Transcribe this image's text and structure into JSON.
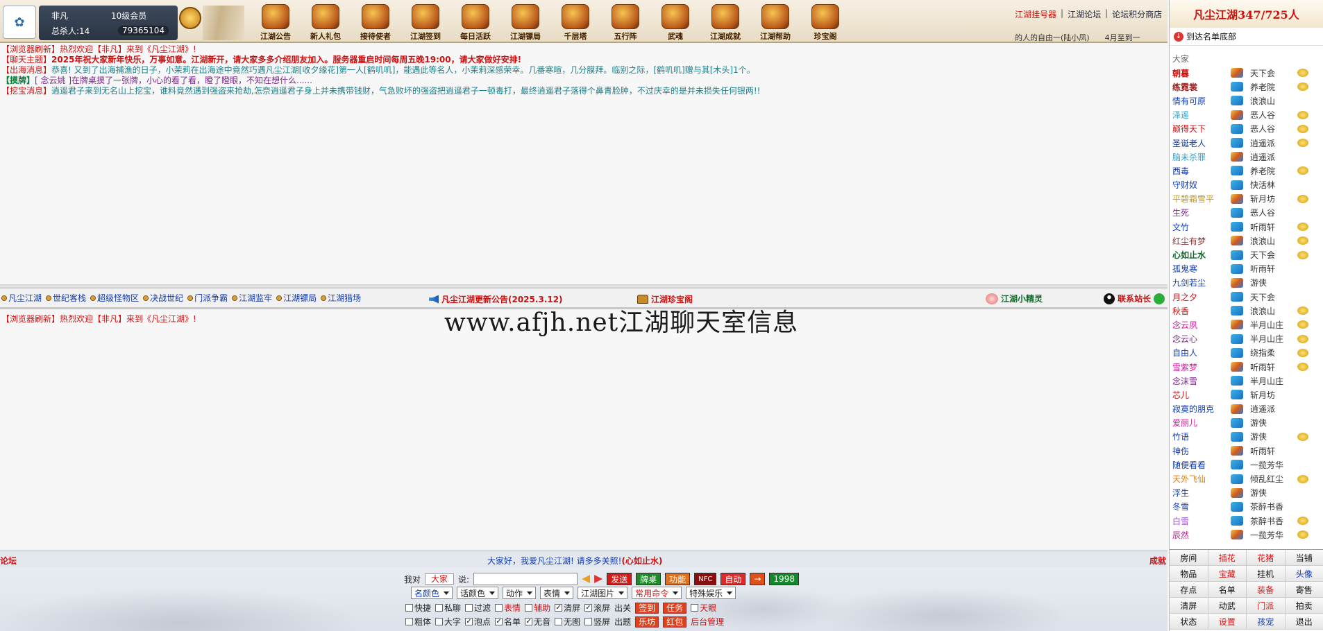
{
  "user": {
    "name": "非凡",
    "level": "10级会员",
    "kills_label": "总杀人:14",
    "gold": "79365104"
  },
  "nav": [
    "江湖公告",
    "新人礼包",
    "接待使者",
    "江湖签到",
    "每日活跃",
    "江湖镖局",
    "千层塔",
    "五行阵",
    "武魂",
    "江湖成就",
    "江湖帮助",
    "珍宝阁"
  ],
  "toplinks": [
    "江湖挂号器",
    "江湖论坛",
    "论坛积分商店"
  ],
  "ticker": [
    "的人的自由一(陆小凤)",
    "4月至到一"
  ],
  "right": {
    "title": "凡尘江湖347/725人",
    "scroll_label": "到达名单底部",
    "room": "大家",
    "users": [
      {
        "name": "朝暮",
        "sect": "天下会",
        "color": "#c11",
        "bold": true,
        "badge": true
      },
      {
        "name": "练霓裳",
        "sect": "养老院",
        "color": "#9a2020",
        "bold": true,
        "badge": true
      },
      {
        "name": "情有可原",
        "sect": "浪浪山",
        "color": "#123bb0",
        "badge": false
      },
      {
        "name": "泽遥",
        "sect": "恶人谷",
        "color": "#3aa0c0",
        "badge": true
      },
      {
        "name": "巅得天下",
        "sect": "恶人谷",
        "color": "#c11",
        "badge": true
      },
      {
        "name": "圣诞老人",
        "sect": "逍遥派",
        "color": "#123bb0",
        "badge": true
      },
      {
        "name": "脑未杀罪",
        "sect": "逍遥派",
        "color": "#3aa0c0",
        "badge": false
      },
      {
        "name": "西毒",
        "sect": "养老院",
        "color": "#123bb0",
        "badge": true
      },
      {
        "name": "守财奴",
        "sect": "快活林",
        "color": "#123bb0",
        "badge": false
      },
      {
        "name": "平碧霜雪平",
        "sect": "斩月坊",
        "color": "#c99a10",
        "badge": true
      },
      {
        "name": "生死",
        "sect": "恶人谷",
        "color": "#7a2a8a",
        "badge": false
      },
      {
        "name": "文竹",
        "sect": "听雨轩",
        "color": "#123bb0",
        "badge": true
      },
      {
        "name": "红尘有梦",
        "sect": "浪浪山",
        "color": "#8a3a3a",
        "badge": true
      },
      {
        "name": "心如止水",
        "sect": "天下会",
        "color": "#0d6a28",
        "bold": true,
        "badge": true
      },
      {
        "name": "孤鬼寒",
        "sect": "听雨轩",
        "color": "#123bb0",
        "badge": false
      },
      {
        "name": "九剑若尘",
        "sect": "游侠",
        "color": "#123bb0",
        "badge": false
      },
      {
        "name": "月之夕",
        "sect": "天下会",
        "color": "#c11",
        "badge": false
      },
      {
        "name": "秋香",
        "sect": "浪浪山",
        "color": "#c11",
        "badge": true
      },
      {
        "name": "念云夙",
        "sect": "半月山庄",
        "color": "#d01a9a",
        "badge": true
      },
      {
        "name": "念云心",
        "sect": "半月山庄",
        "color": "#7a2a8a",
        "badge": true
      },
      {
        "name": "自由人",
        "sect": "绕指柔",
        "color": "#123bb0",
        "badge": true
      },
      {
        "name": "雪紫梦",
        "sect": "听雨轩",
        "color": "#d01a9a",
        "badge": true
      },
      {
        "name": "念沫雪",
        "sect": "半月山庄",
        "color": "#7a2a8a",
        "badge": false
      },
      {
        "name": "芯儿",
        "sect": "斩月坊",
        "color": "#c11",
        "badge": false
      },
      {
        "name": "寂寞的朋克",
        "sect": "逍遥派",
        "color": "#123bb0",
        "badge": false
      },
      {
        "name": "爱丽儿",
        "sect": "游侠",
        "color": "#d01a9a",
        "badge": false
      },
      {
        "name": "竹语",
        "sect": "游侠",
        "color": "#123bb0",
        "badge": true
      },
      {
        "name": "神伤",
        "sect": "听雨轩",
        "color": "#123bb0",
        "badge": false
      },
      {
        "name": "随便看看",
        "sect": "一揽芳华",
        "color": "#123bb0",
        "badge": false
      },
      {
        "name": "天外飞仙",
        "sect": "倾乱红尘",
        "color": "#e0801a",
        "badge": true
      },
      {
        "name": "浮生",
        "sect": "游侠",
        "color": "#123bb0",
        "badge": false
      },
      {
        "name": "冬雪",
        "sect": "茶醉书香",
        "color": "#123bb0",
        "badge": false
      },
      {
        "name": "白雪",
        "sect": "茶醉书香",
        "color": "#9a50d0",
        "badge": true
      },
      {
        "name": "辰然",
        "sect": "一揽芳华",
        "color": "#d01a9a",
        "badge": true
      }
    ],
    "grid": [
      {
        "label": "房间",
        "c": ""
      },
      {
        "label": "插花",
        "c": "red"
      },
      {
        "label": "花猪",
        "c": "red"
      },
      {
        "label": "当铺",
        "c": ""
      },
      {
        "label": "物品",
        "c": ""
      },
      {
        "label": "宝藏",
        "c": "red"
      },
      {
        "label": "挂机",
        "c": ""
      },
      {
        "label": "头像",
        "c": "blue"
      },
      {
        "label": "存点",
        "c": ""
      },
      {
        "label": "名单",
        "c": ""
      },
      {
        "label": "装备",
        "c": "red"
      },
      {
        "label": "寄售",
        "c": ""
      },
      {
        "label": "清屏",
        "c": ""
      },
      {
        "label": "动武",
        "c": ""
      },
      {
        "label": "门派",
        "c": "red"
      },
      {
        "label": "拍卖",
        "c": ""
      },
      {
        "label": "状态",
        "c": ""
      },
      {
        "label": "设置",
        "c": "red"
      },
      {
        "label": "孩宠",
        "c": "blue"
      },
      {
        "label": "退出",
        "c": ""
      }
    ]
  },
  "messages_top": {
    "m1_tag": "【浏览器刷新】",
    "m1_text": "热烈欢迎【非凡】来到《凡尘江湖》!",
    "m2_tag": "【聊天主题】",
    "m2_text": "2025年祝大家新年快乐，万事如意。江湖新开，请大家多多介绍朋友加入。服务器重启时间每周五晚19:00，请大家做好安排!",
    "m3_tag": "【出海消息】",
    "m3_text": "恭喜!  又到了出海捕渔的日子，小茉莉在出海途中竟然巧遇凡尘江湖[收夕缘花]第一人[鹤叽叽]，能遇此等名人，小茉莉深感荣幸。几番寒暄，几分膜拜。临别之际，[鹤叽叽]赠与其[木头]1个。",
    "m4_tag": "【摸牌】",
    "m4_text": "[ 念云姚 ]在牌桌摸了一张牌，小心的看了看，瞪了瞪眼，不知在想什么......",
    "m5_tag": "【挖宝消息】",
    "m5_text": "逍遥君子来到无名山上挖宝，谁料竟然遇到强盗来抢劫,怎奈逍遥君子身上并未携带钱财，气急败坏的强盗把逍遥君子一顿毒打，最终逍遥君子落得个鼻青脸肿，不过庆幸的是并未损失任何银两!!"
  },
  "linkbar": {
    "links": [
      "凡尘江湖",
      "世纪客栈",
      "超级怪物区",
      "决战世纪",
      "门派争霸",
      "江湖监牢",
      "江湖镖局",
      "江湖猎场"
    ],
    "notice": "凡尘江湖更新公告(2025.3.12)",
    "treasure": "江湖珍宝阁",
    "sprite": "江湖小精灵",
    "contact": "联系站长"
  },
  "messages_bottom": {
    "m1_tag": "【浏览器刷新】",
    "m1_text": "热烈欢迎【非凡】来到《凡尘江湖》!"
  },
  "watermark": "www.afjh.net江湖聊天室信息",
  "status": {
    "left": "论坛",
    "mid": "大家好，我爱凡尘江湖! 请多多关照!",
    "mid_name": "(心如止水)",
    "right": "成就"
  },
  "input": {
    "say_prefix": "我对",
    "target": "大家",
    "say_suffix": "说:",
    "buttons": [
      "发送",
      "牌桌",
      "功能",
      "NFC",
      "自动",
      "→",
      "1998"
    ],
    "selects": [
      "名颜色",
      "话颜色",
      "动作",
      "表情",
      "江湖图片",
      "常用命令",
      "特殊娱乐"
    ],
    "row3": [
      {
        "label": "快捷",
        "checked": false,
        "c": ""
      },
      {
        "label": "私聊",
        "checked": false,
        "c": ""
      },
      {
        "label": "过滤",
        "checked": false,
        "c": ""
      },
      {
        "label": "表情",
        "checked": false,
        "c": "red"
      },
      {
        "label": "辅助",
        "checked": false,
        "c": "red"
      },
      {
        "label": "清屏",
        "checked": true,
        "c": ""
      },
      {
        "label": "滚屏",
        "checked": true,
        "c": ""
      }
    ],
    "row3_extra": {
      "plain": "出关",
      "b1": "签到",
      "b2": "任务",
      "cb": "天眼"
    },
    "row4": [
      {
        "label": "粗体",
        "checked": false,
        "c": ""
      },
      {
        "label": "大字",
        "checked": false,
        "c": ""
      },
      {
        "label": "泡点",
        "checked": true,
        "c": ""
      },
      {
        "label": "名单",
        "checked": true,
        "c": ""
      },
      {
        "label": "无音",
        "checked": true,
        "c": ""
      },
      {
        "label": "无图",
        "checked": false,
        "c": ""
      },
      {
        "label": "竖屏",
        "checked": false,
        "c": ""
      }
    ],
    "row4_extra": {
      "plain": "出题",
      "b1": "乐坊",
      "b2": "红包",
      "link": "后台管理"
    }
  }
}
